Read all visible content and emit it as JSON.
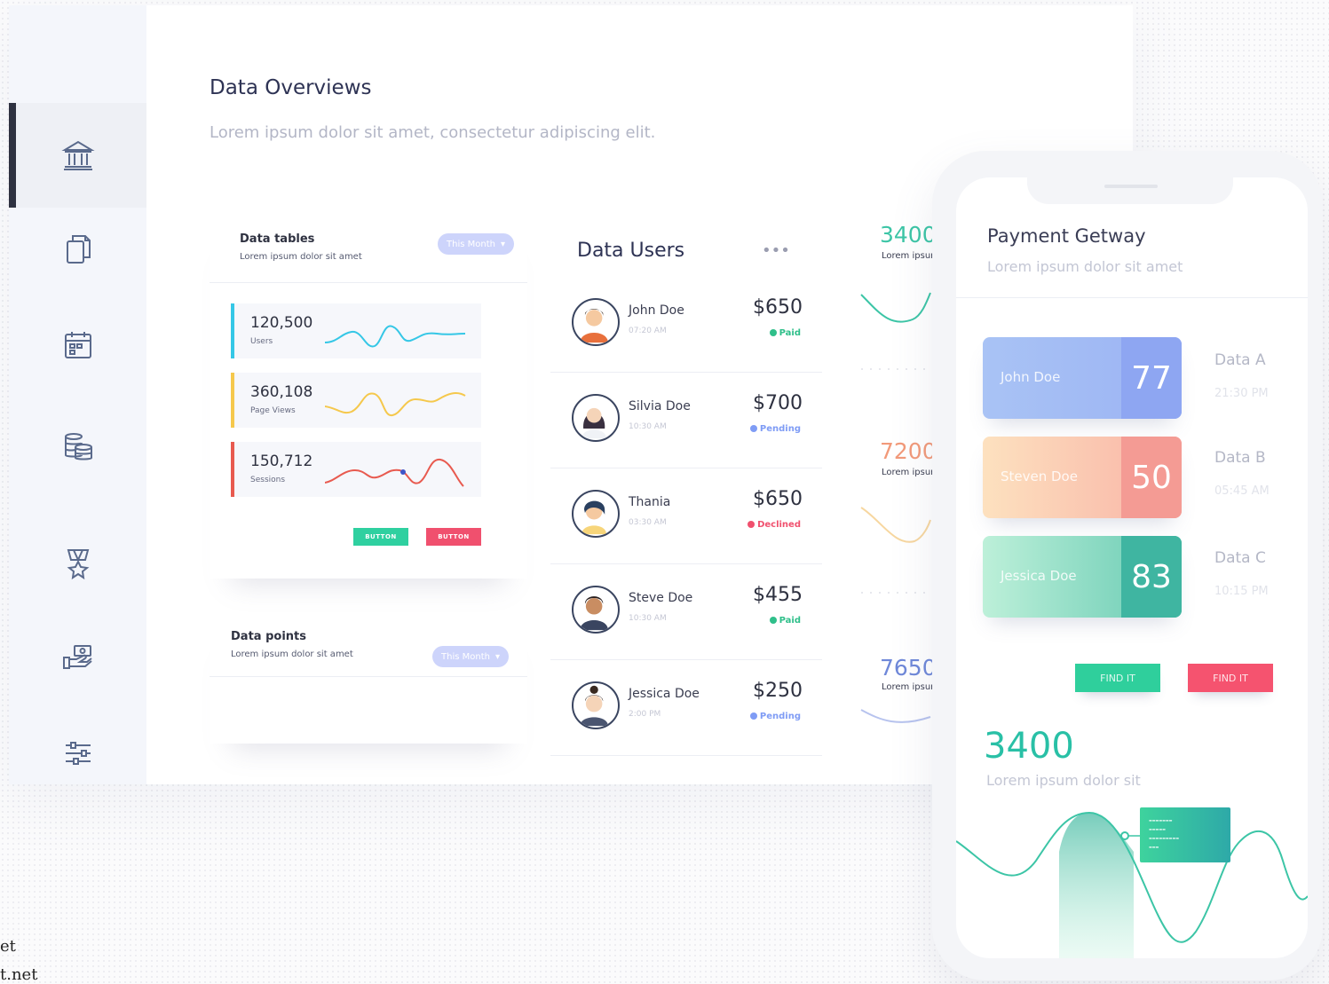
{
  "header": {
    "title": "Data Overviews",
    "subtitle": "Lorem ipsum dolor sit amet, consectetur adipiscing elit."
  },
  "sidebar": {
    "items": [
      {
        "icon": "bank-icon",
        "active": true
      },
      {
        "icon": "copy-icon",
        "active": false
      },
      {
        "icon": "calendar-icon",
        "active": false
      },
      {
        "icon": "coins-icon",
        "active": false
      },
      {
        "icon": "award-icon",
        "active": false
      },
      {
        "icon": "payment-hand-icon",
        "active": false
      },
      {
        "icon": "sliders-icon",
        "active": false
      }
    ]
  },
  "data_tables": {
    "title": "Data tables",
    "subtitle": "Lorem ipsum dolor sit amet",
    "filter": "This Month",
    "metrics": [
      {
        "value": "120,500",
        "label": "Users",
        "color": "#35c7e6"
      },
      {
        "value": "360,108",
        "label": "Page Views",
        "color": "#f5c84c"
      },
      {
        "value": "150,712",
        "label": "Sessions",
        "color": "#e85a4f"
      }
    ],
    "buttons": [
      {
        "label": "BUTTON",
        "color": "#2fd0a0"
      },
      {
        "label": "BUTTON",
        "color": "#f0506e"
      }
    ]
  },
  "data_points": {
    "title": "Data points",
    "subtitle": "Lorem ipsum dolor sit amet",
    "filter": "This Month"
  },
  "data_users": {
    "title": "Data Users",
    "more": "•••",
    "users": [
      {
        "name": "John Doe",
        "time": "07:20 AM",
        "amount": "$650",
        "status": "Paid",
        "status_color": "#2fbf8a"
      },
      {
        "name": "Silvia Doe",
        "time": "10:30 AM",
        "amount": "$700",
        "status": "Pending",
        "status_color": "#7f9cf5"
      },
      {
        "name": "Thania",
        "time": "03:30 AM",
        "amount": "$650",
        "status": "Declined",
        "status_color": "#f0506e"
      },
      {
        "name": "Steve Doe",
        "time": "10:30 AM",
        "amount": "$455",
        "status": "Paid",
        "status_color": "#2fbf8a"
      },
      {
        "name": "Jessica Doe",
        "time": "2:00 PM",
        "amount": "$250",
        "status": "Pending",
        "status_color": "#7f9cf5"
      }
    ]
  },
  "side_stats": [
    {
      "value": "3400",
      "label": "Lorem ipsum",
      "color": "#3cc5a6"
    },
    {
      "value": "7200",
      "label": "Lorem ipsum",
      "color": "#f29a7a"
    },
    {
      "value": "7650",
      "label": "Lorem ipsum",
      "color": "#6f88d9"
    }
  ],
  "phone": {
    "title": "Payment Getway",
    "subtitle": "Lorem ipsum dolor sit amet",
    "cards": [
      {
        "name": "John Doe",
        "score": "77",
        "data_label": "Data A",
        "time": "21:30 PM"
      },
      {
        "name": "Steven Doe",
        "score": "50",
        "data_label": "Data B",
        "time": "05:45 AM"
      },
      {
        "name": "Jessica Doe",
        "score": "83",
        "data_label": "Data C",
        "time": "10:15 PM"
      }
    ],
    "buttons": [
      {
        "label": "FIND IT",
        "color": "#2fcf9c"
      },
      {
        "label": "FIND IT",
        "color": "#f5536f"
      }
    ],
    "total": "3400",
    "total_sub": "Lorem ipsum dolor sit"
  },
  "watermark": {
    "line1": "et",
    "line2": "t.net"
  }
}
